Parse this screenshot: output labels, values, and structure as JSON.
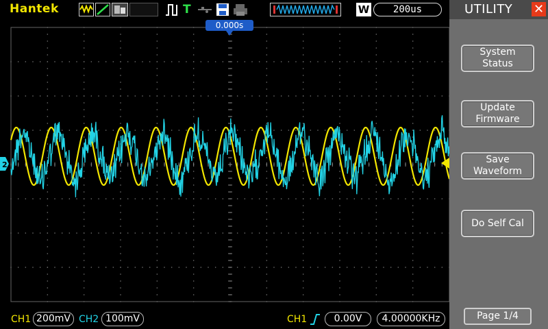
{
  "header": {
    "brand": "Hantek",
    "timebase": "200us",
    "trigger_position": "0.000s",
    "window_mode": "W",
    "run_status": "T"
  },
  "menu": {
    "title": "UTILITY",
    "buttons": [
      {
        "line1": "System",
        "line2": "Status"
      },
      {
        "line1": "Update",
        "line2": "Firmware"
      },
      {
        "line1": "Save",
        "line2": "Waveform"
      },
      {
        "line1": "Do Self Cal",
        "line2": ""
      }
    ],
    "page": "Page 1/4"
  },
  "bottom": {
    "ch1_label": "CH1",
    "ch1_scale": "200mV",
    "ch2_label": "CH2",
    "ch2_scale": "100mV",
    "trig_source": "CH1",
    "trig_level": "0.00V",
    "frequency": "4.00000KHz"
  },
  "channels": {
    "ch2_marker": "2"
  },
  "colors": {
    "ch1": "#f2e600",
    "ch2": "#22d3e6",
    "trigger_marker": "#1e5cc8",
    "close": "#e63a1a",
    "menu_bg": "#6e6e6e"
  }
}
